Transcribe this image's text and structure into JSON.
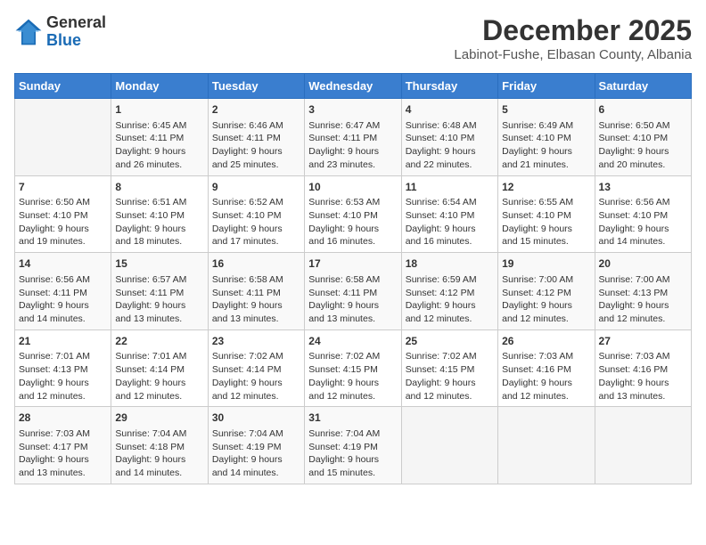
{
  "header": {
    "logo_general": "General",
    "logo_blue": "Blue",
    "title": "December 2025",
    "location": "Labinot-Fushe, Elbasan County, Albania"
  },
  "days_of_week": [
    "Sunday",
    "Monday",
    "Tuesday",
    "Wednesday",
    "Thursday",
    "Friday",
    "Saturday"
  ],
  "weeks": [
    [
      {
        "day": "",
        "content": ""
      },
      {
        "day": "1",
        "content": "Sunrise: 6:45 AM\nSunset: 4:11 PM\nDaylight: 9 hours\nand 26 minutes."
      },
      {
        "day": "2",
        "content": "Sunrise: 6:46 AM\nSunset: 4:11 PM\nDaylight: 9 hours\nand 25 minutes."
      },
      {
        "day": "3",
        "content": "Sunrise: 6:47 AM\nSunset: 4:11 PM\nDaylight: 9 hours\nand 23 minutes."
      },
      {
        "day": "4",
        "content": "Sunrise: 6:48 AM\nSunset: 4:10 PM\nDaylight: 9 hours\nand 22 minutes."
      },
      {
        "day": "5",
        "content": "Sunrise: 6:49 AM\nSunset: 4:10 PM\nDaylight: 9 hours\nand 21 minutes."
      },
      {
        "day": "6",
        "content": "Sunrise: 6:50 AM\nSunset: 4:10 PM\nDaylight: 9 hours\nand 20 minutes."
      }
    ],
    [
      {
        "day": "7",
        "content": "Sunrise: 6:50 AM\nSunset: 4:10 PM\nDaylight: 9 hours\nand 19 minutes."
      },
      {
        "day": "8",
        "content": "Sunrise: 6:51 AM\nSunset: 4:10 PM\nDaylight: 9 hours\nand 18 minutes."
      },
      {
        "day": "9",
        "content": "Sunrise: 6:52 AM\nSunset: 4:10 PM\nDaylight: 9 hours\nand 17 minutes."
      },
      {
        "day": "10",
        "content": "Sunrise: 6:53 AM\nSunset: 4:10 PM\nDaylight: 9 hours\nand 16 minutes."
      },
      {
        "day": "11",
        "content": "Sunrise: 6:54 AM\nSunset: 4:10 PM\nDaylight: 9 hours\nand 16 minutes."
      },
      {
        "day": "12",
        "content": "Sunrise: 6:55 AM\nSunset: 4:10 PM\nDaylight: 9 hours\nand 15 minutes."
      },
      {
        "day": "13",
        "content": "Sunrise: 6:56 AM\nSunset: 4:10 PM\nDaylight: 9 hours\nand 14 minutes."
      }
    ],
    [
      {
        "day": "14",
        "content": "Sunrise: 6:56 AM\nSunset: 4:11 PM\nDaylight: 9 hours\nand 14 minutes."
      },
      {
        "day": "15",
        "content": "Sunrise: 6:57 AM\nSunset: 4:11 PM\nDaylight: 9 hours\nand 13 minutes."
      },
      {
        "day": "16",
        "content": "Sunrise: 6:58 AM\nSunset: 4:11 PM\nDaylight: 9 hours\nand 13 minutes."
      },
      {
        "day": "17",
        "content": "Sunrise: 6:58 AM\nSunset: 4:11 PM\nDaylight: 9 hours\nand 13 minutes."
      },
      {
        "day": "18",
        "content": "Sunrise: 6:59 AM\nSunset: 4:12 PM\nDaylight: 9 hours\nand 12 minutes."
      },
      {
        "day": "19",
        "content": "Sunrise: 7:00 AM\nSunset: 4:12 PM\nDaylight: 9 hours\nand 12 minutes."
      },
      {
        "day": "20",
        "content": "Sunrise: 7:00 AM\nSunset: 4:13 PM\nDaylight: 9 hours\nand 12 minutes."
      }
    ],
    [
      {
        "day": "21",
        "content": "Sunrise: 7:01 AM\nSunset: 4:13 PM\nDaylight: 9 hours\nand 12 minutes."
      },
      {
        "day": "22",
        "content": "Sunrise: 7:01 AM\nSunset: 4:14 PM\nDaylight: 9 hours\nand 12 minutes."
      },
      {
        "day": "23",
        "content": "Sunrise: 7:02 AM\nSunset: 4:14 PM\nDaylight: 9 hours\nand 12 minutes."
      },
      {
        "day": "24",
        "content": "Sunrise: 7:02 AM\nSunset: 4:15 PM\nDaylight: 9 hours\nand 12 minutes."
      },
      {
        "day": "25",
        "content": "Sunrise: 7:02 AM\nSunset: 4:15 PM\nDaylight: 9 hours\nand 12 minutes."
      },
      {
        "day": "26",
        "content": "Sunrise: 7:03 AM\nSunset: 4:16 PM\nDaylight: 9 hours\nand 12 minutes."
      },
      {
        "day": "27",
        "content": "Sunrise: 7:03 AM\nSunset: 4:16 PM\nDaylight: 9 hours\nand 13 minutes."
      }
    ],
    [
      {
        "day": "28",
        "content": "Sunrise: 7:03 AM\nSunset: 4:17 PM\nDaylight: 9 hours\nand 13 minutes."
      },
      {
        "day": "29",
        "content": "Sunrise: 7:04 AM\nSunset: 4:18 PM\nDaylight: 9 hours\nand 14 minutes."
      },
      {
        "day": "30",
        "content": "Sunrise: 7:04 AM\nSunset: 4:19 PM\nDaylight: 9 hours\nand 14 minutes."
      },
      {
        "day": "31",
        "content": "Sunrise: 7:04 AM\nSunset: 4:19 PM\nDaylight: 9 hours\nand 15 minutes."
      },
      {
        "day": "",
        "content": ""
      },
      {
        "day": "",
        "content": ""
      },
      {
        "day": "",
        "content": ""
      }
    ]
  ]
}
